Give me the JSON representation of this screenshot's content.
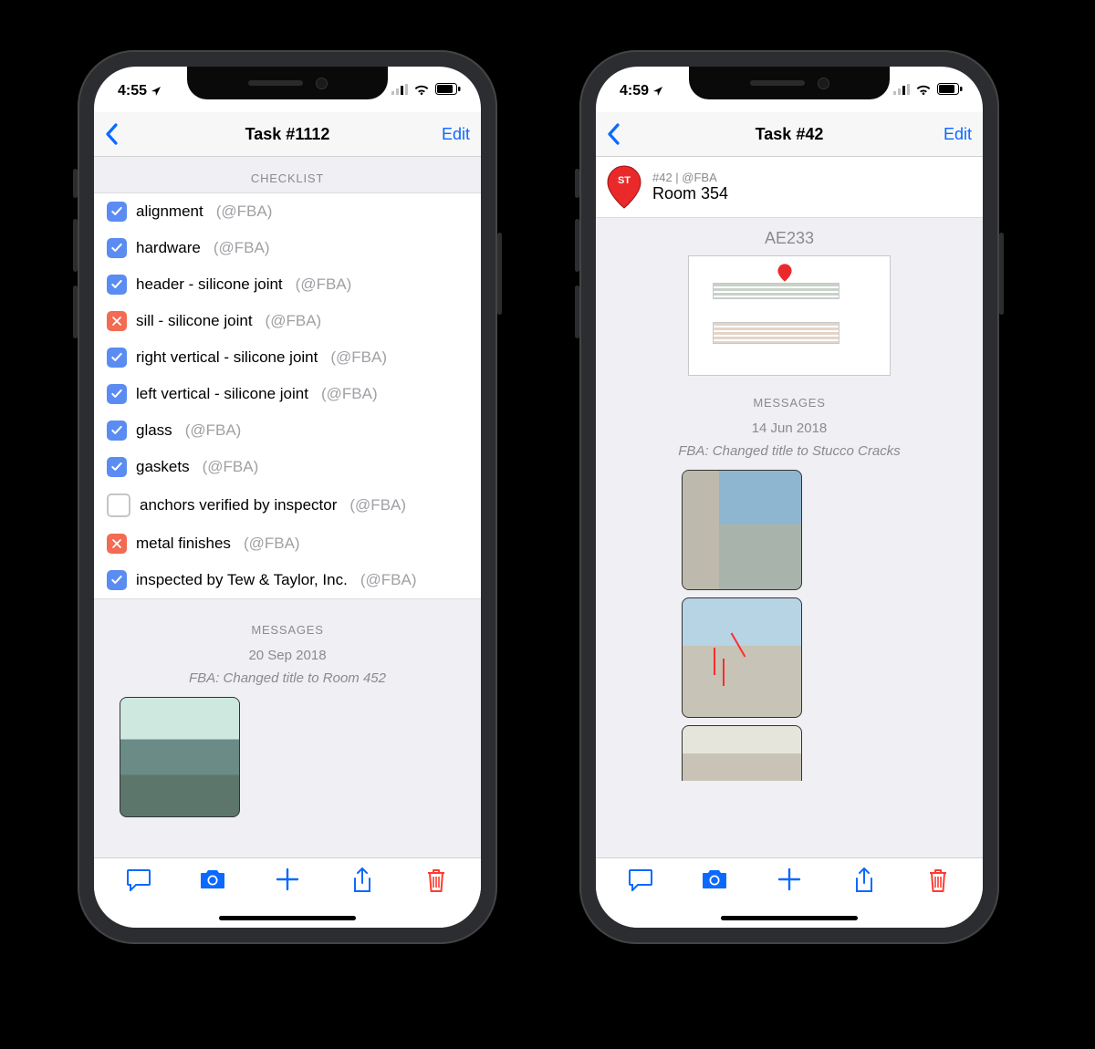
{
  "phones": {
    "left": {
      "status_time": "4:55",
      "nav": {
        "title": "Task #1112",
        "edit": "Edit"
      },
      "sections": {
        "checklist_header": "CHECKLIST",
        "messages_header": "MESSAGES"
      },
      "checklist": [
        {
          "label": "alignment",
          "meta": "(@FBA)",
          "state": "checked"
        },
        {
          "label": "hardware",
          "meta": "(@FBA)",
          "state": "checked"
        },
        {
          "label": "header - silicone joint",
          "meta": "(@FBA)",
          "state": "checked"
        },
        {
          "label": "sill - silicone joint",
          "meta": "(@FBA)",
          "state": "failed"
        },
        {
          "label": "right vertical - silicone joint",
          "meta": "(@FBA)",
          "state": "checked"
        },
        {
          "label": "left vertical - silicone joint",
          "meta": "(@FBA)",
          "state": "checked"
        },
        {
          "label": "glass",
          "meta": "(@FBA)",
          "state": "checked"
        },
        {
          "label": "gaskets",
          "meta": "(@FBA)",
          "state": "checked"
        },
        {
          "label": "anchors verified by inspector",
          "meta": "(@FBA)",
          "state": "empty"
        },
        {
          "label": "metal finishes",
          "meta": "(@FBA)",
          "state": "failed"
        },
        {
          "label": "inspected by Tew & Taylor, Inc.",
          "meta": "(@FBA)",
          "state": "checked"
        }
      ],
      "messages": {
        "date": "20 Sep 2018",
        "change": "FBA: Changed title to Room 452"
      }
    },
    "right": {
      "status_time": "4:59",
      "nav": {
        "title": "Task #42",
        "edit": "Edit"
      },
      "task_header": {
        "pin_code": "ST",
        "sub": "#42 | @FBA",
        "name": "Room 354"
      },
      "plan_label": "AE233",
      "sections": {
        "messages_header": "MESSAGES"
      },
      "messages": {
        "date": "14 Jun 2018",
        "change": "FBA: Changed title to Stucco Cracks"
      }
    }
  },
  "colors": {
    "ios_blue": "#0b69ff",
    "ios_red": "#ff3b30",
    "check_blue": "#5a8cf2",
    "fail_orange": "#f26b52",
    "pin_red": "#ea2a2a"
  }
}
